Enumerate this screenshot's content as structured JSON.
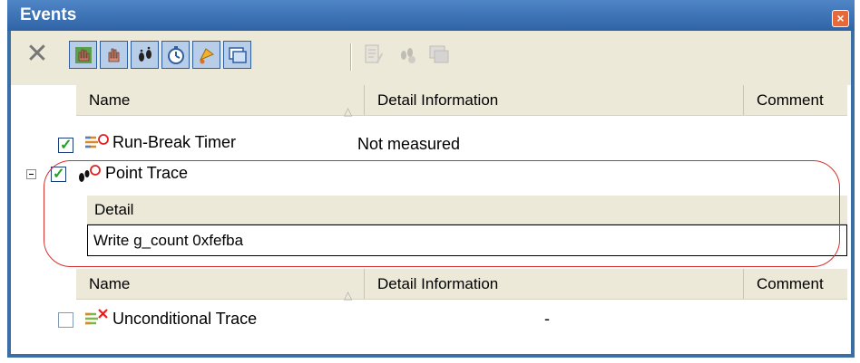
{
  "window": {
    "title": "Events",
    "close_icon": "close-icon"
  },
  "toolbar": {
    "buttons": [
      {
        "name": "delete-icon",
        "enabled": true
      },
      {
        "name": "hardware-break-icon",
        "enabled": true
      },
      {
        "name": "software-break-icon",
        "enabled": true
      },
      {
        "name": "trace-icon",
        "enabled": true
      },
      {
        "name": "timer-icon",
        "enabled": true
      },
      {
        "name": "action-event-icon",
        "enabled": true
      },
      {
        "name": "other-event-icon",
        "enabled": true
      },
      {
        "name": "edit-icon",
        "enabled": false
      },
      {
        "name": "settings-icon",
        "enabled": false
      },
      {
        "name": "export-icon",
        "enabled": false
      }
    ]
  },
  "table1": {
    "columns": [
      "Name",
      "Detail Information",
      "Comment"
    ],
    "rows": [
      {
        "checked": true,
        "icon": "timer-event-icon",
        "name": "Run-Break Timer",
        "detail": "Not measured"
      },
      {
        "checked": true,
        "icon": "trace-point-icon",
        "name": "Point Trace",
        "detail": ""
      }
    ],
    "detail_header": "Detail",
    "detail_value": "Write  g_count 0xfefba"
  },
  "table2": {
    "columns": [
      "Name",
      "Detail Information",
      "Comment"
    ],
    "rows": [
      {
        "checked": false,
        "icon": "unconditional-trace-icon",
        "name": "Unconditional Trace",
        "detail": "-"
      }
    ]
  },
  "colors": {
    "titlebar": "#3a6ea5",
    "annotation": "#d9302d",
    "check": "#21a121"
  }
}
